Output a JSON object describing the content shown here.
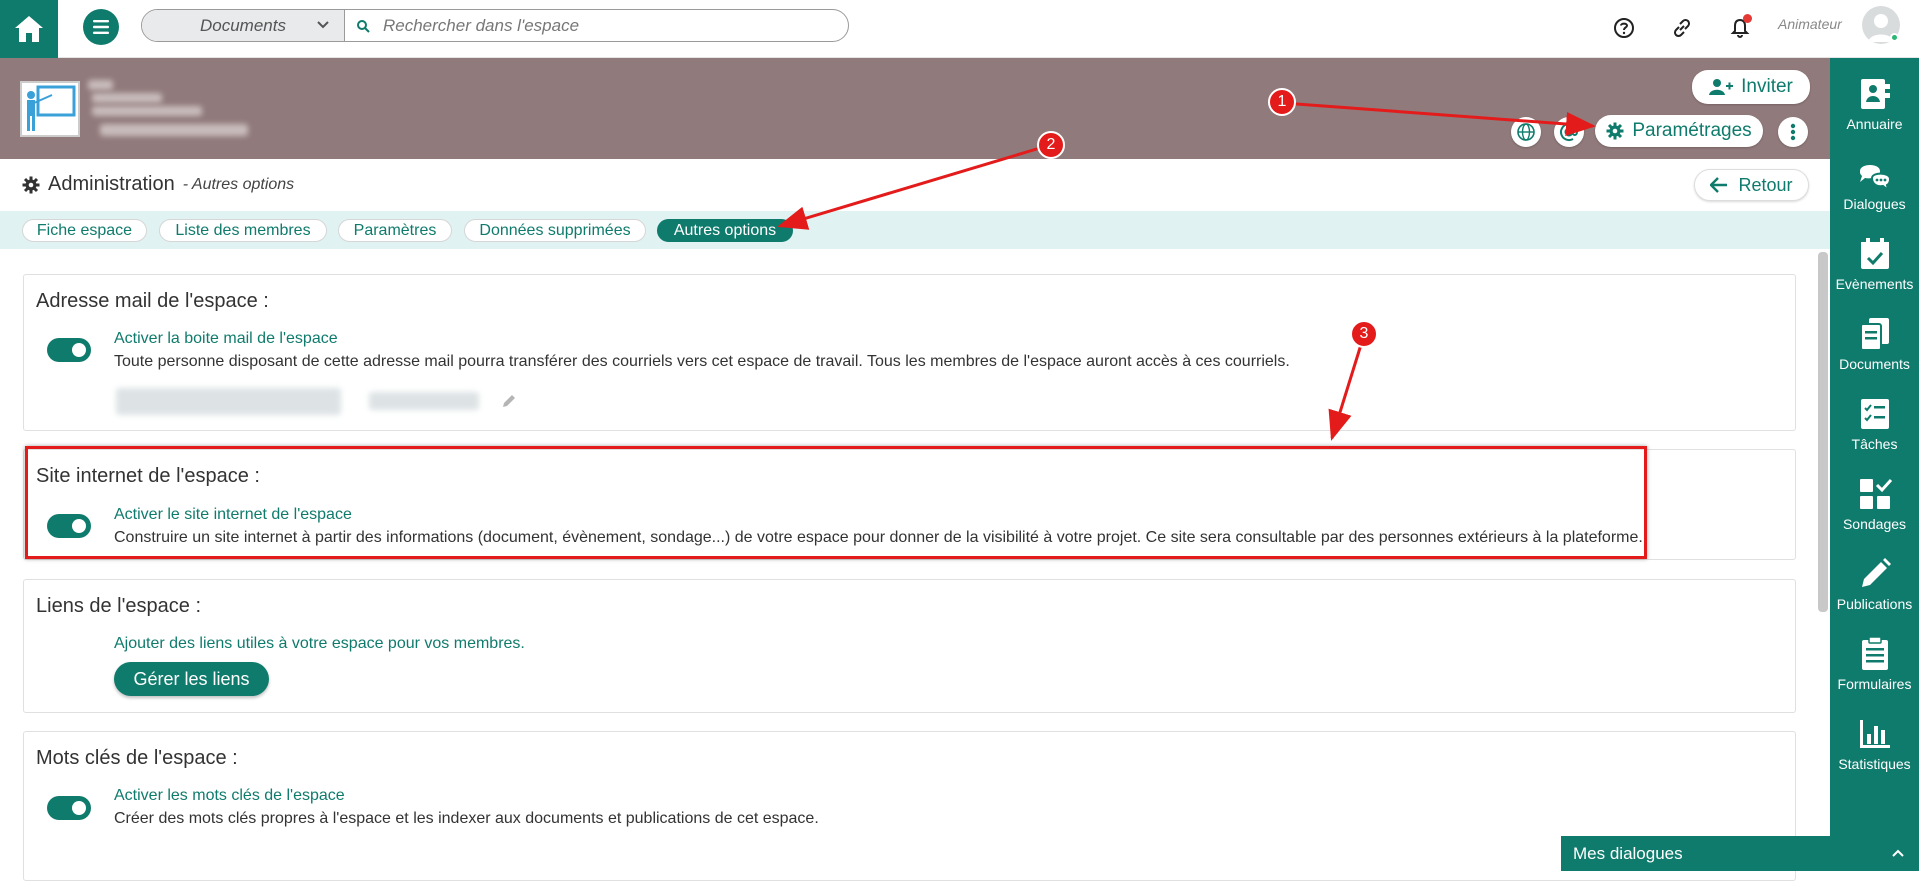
{
  "topbar": {
    "search_scope": "Documents",
    "search_placeholder": "Rechercher dans l'espace",
    "user_role": "Animateur"
  },
  "header": {
    "invite_label": "Inviter",
    "settings_label": "Paramétrages"
  },
  "admin": {
    "title": "Administration",
    "subtitle": "- Autres options",
    "back_label": "Retour"
  },
  "tabs": [
    {
      "label": "Fiche espace",
      "active": false
    },
    {
      "label": "Liste des membres",
      "active": false
    },
    {
      "label": "Paramètres",
      "active": false
    },
    {
      "label": "Données supprimées",
      "active": false
    },
    {
      "label": "Autres options",
      "active": true
    }
  ],
  "sections": {
    "mail": {
      "title": "Adresse mail de l'espace :",
      "toggle_on": true,
      "link": "Activer la boite mail de l'espace",
      "desc": "Toute personne disposant de cette adresse mail pourra transférer des courriels vers cet espace de travail. Tous les membres de l'espace auront accès à ces courriels."
    },
    "site": {
      "title": "Site internet de l'espace :",
      "toggle_on": true,
      "link": "Activer le site internet de l'espace",
      "desc": "Construire un site internet à partir des informations (document, évènement, sondage...) de votre espace pour donner de la visibilité à votre projet. Ce site sera consultable par des personnes extérieurs à la plateforme."
    },
    "links": {
      "title": "Liens de l'espace :",
      "link": "Ajouter des liens utiles à votre espace pour vos membres.",
      "button": "Gérer les liens"
    },
    "keywords": {
      "title": "Mots clés de l'espace :",
      "toggle_on": true,
      "link": "Activer les mots clés de l'espace",
      "desc": "Créer des mots clés propres à l'espace et les indexer aux documents et publications de cet espace."
    }
  },
  "sidebar": {
    "items": [
      {
        "label": "Annuaire",
        "icon": "directory-icon"
      },
      {
        "label": "Dialogues",
        "icon": "chat-icon"
      },
      {
        "label": "Evènements",
        "icon": "calendar-icon"
      },
      {
        "label": "Documents",
        "icon": "documents-icon"
      },
      {
        "label": "Tâches",
        "icon": "tasks-icon"
      },
      {
        "label": "Sondages",
        "icon": "polls-icon"
      },
      {
        "label": "Publications",
        "icon": "pencil-icon"
      },
      {
        "label": "Formulaires",
        "icon": "forms-icon"
      },
      {
        "label": "Statistiques",
        "icon": "stats-icon"
      }
    ]
  },
  "dialogs_bar": {
    "label": "Mes dialogues"
  },
  "annotations": {
    "badges": [
      "1",
      "2",
      "3"
    ],
    "color": "#e31b1b"
  },
  "colors": {
    "primary": "#0f7b6c",
    "header_band": "#917a7b",
    "tabs_band": "#e0f2f2"
  }
}
